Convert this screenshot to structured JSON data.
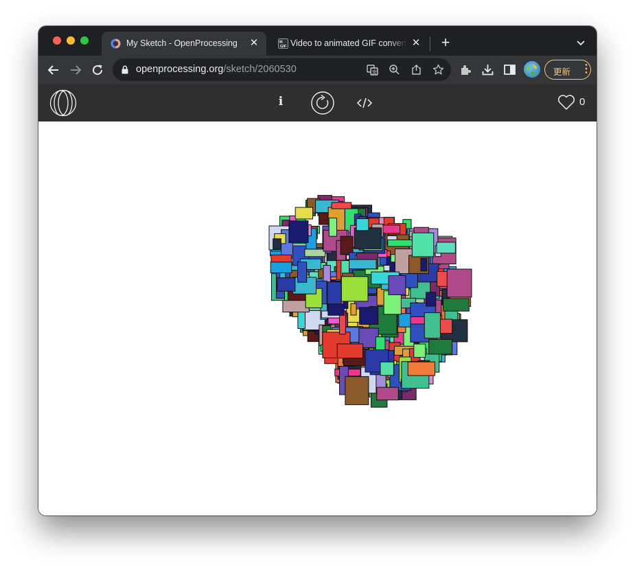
{
  "browser": {
    "tabs": [
      {
        "title": "My Sketch - OpenProcessing",
        "favicon": "openprocessing-favicon",
        "active": true
      },
      {
        "title": "Video to animated GIF converter",
        "favicon": "gif-favicon",
        "active": false
      }
    ],
    "url": {
      "host": "openprocessing.org",
      "path": "/sketch/2060530"
    },
    "update_label": "更新",
    "icons": [
      "back-icon",
      "forward-icon",
      "reload-icon",
      "lock-icon",
      "translate-icon",
      "zoom-icon",
      "share-icon",
      "bookmark-star-icon",
      "extensions-icon",
      "download-icon",
      "sidepanel-icon",
      "profile-avatar",
      "more-icon",
      "tab-search-chevron-icon"
    ]
  },
  "openprocessing": {
    "info_label": "i",
    "likes": "0",
    "icons": [
      "openprocessing-logo",
      "info-icon",
      "restart-icon",
      "code-icon",
      "heart-icon"
    ]
  },
  "sketch": {
    "description": "p5.js canvas: cluster of overlapping randomly colored rectangles",
    "background": "#ffffff",
    "stroke": "#111111",
    "palette": [
      "#1a1a6e",
      "#a78bdc",
      "#5ce0c0",
      "#e83a8a",
      "#38d8d8",
      "#7cf07a",
      "#e33b2e",
      "#1f7a3e",
      "#f07a3a",
      "#5a7ae0",
      "#c0a0a0",
      "#e6dc4a",
      "#213040",
      "#5a1a1a",
      "#9be03a",
      "#2a3aa8",
      "#f05ad0",
      "#38b8d0",
      "#aad4a0",
      "#d0d8f0",
      "#f04a4a",
      "#2ee070",
      "#8a5a2a",
      "#6a4ab8",
      "#e08acb",
      "#1aa0e0",
      "#b04a8a",
      "#40c090",
      "#e0a030",
      "#7a2a6a",
      "#3050c0",
      "#50e0a8"
    ]
  }
}
